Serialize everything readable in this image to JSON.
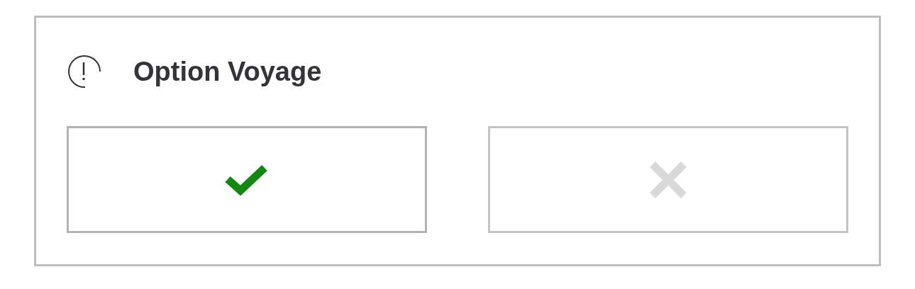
{
  "title": "Option Voyage",
  "choices": [
    {
      "kind": "yes",
      "selected": true
    },
    {
      "kind": "no",
      "selected": false
    }
  ]
}
